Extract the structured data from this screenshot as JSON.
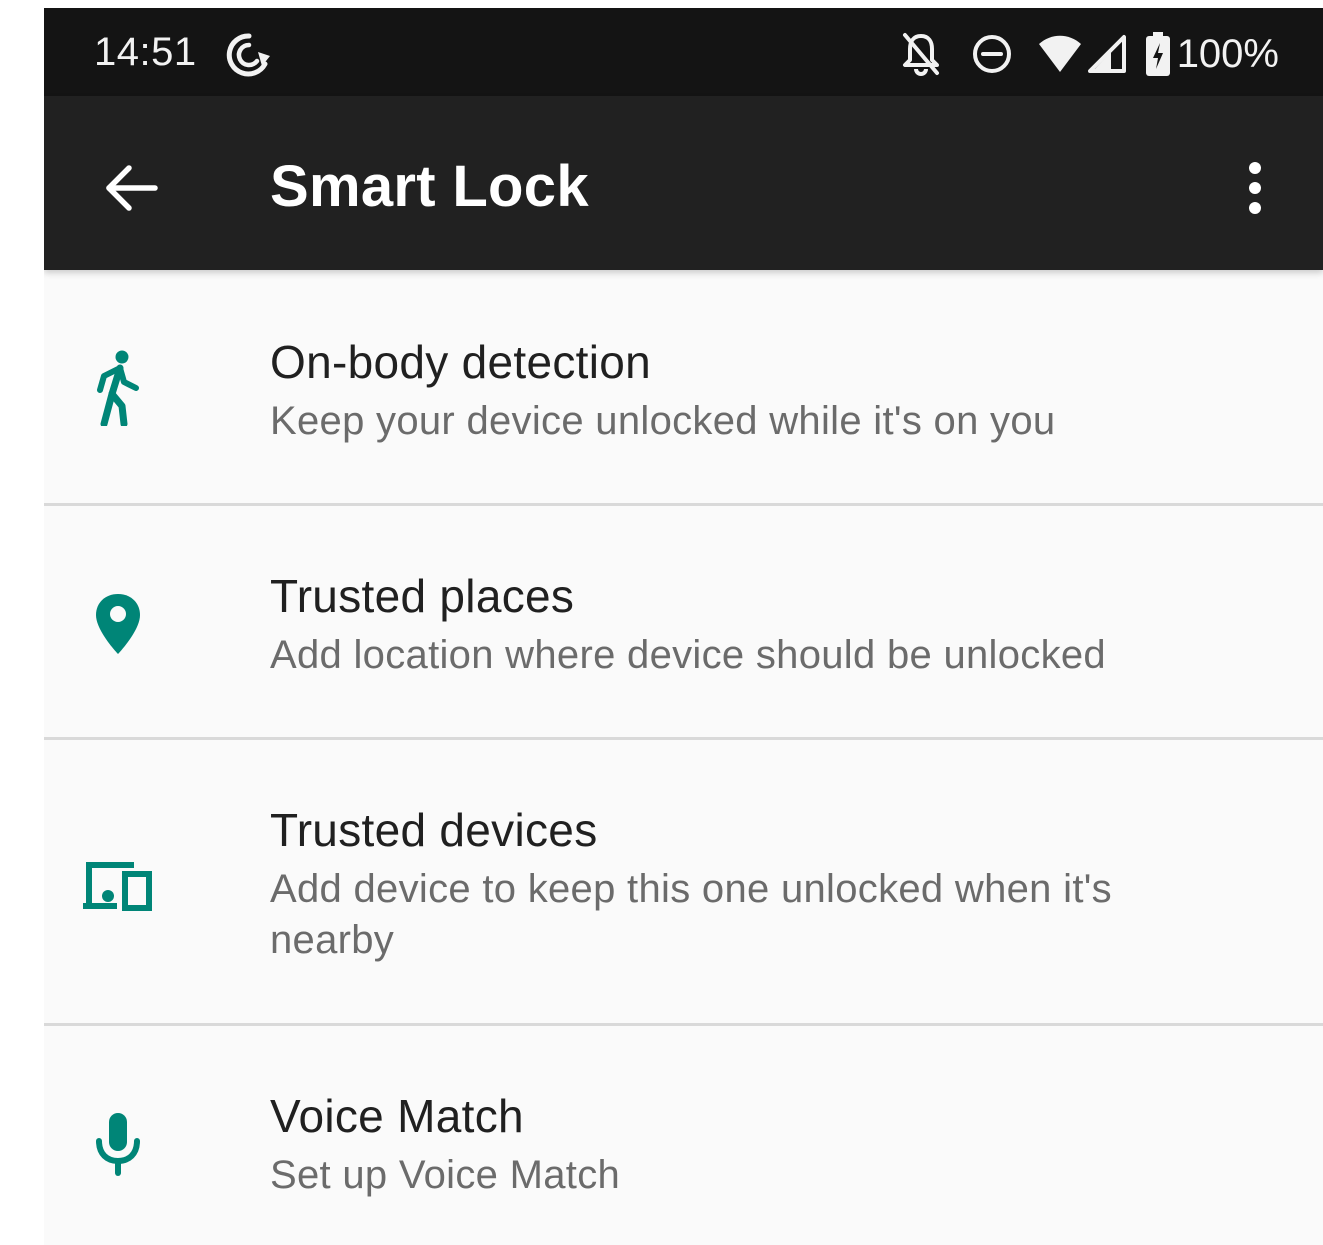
{
  "status_bar": {
    "time": "14:51",
    "battery_percent": "100%",
    "icons": [
      "sync-icon",
      "notifications-off-icon",
      "do-not-disturb-icon",
      "wifi-icon",
      "cell-signal-icon",
      "battery-charging-icon"
    ]
  },
  "app_bar": {
    "title": "Smart Lock",
    "back_icon": "arrow-back-icon",
    "overflow_icon": "more-vert-icon"
  },
  "colors": {
    "accent": "#008577",
    "app_bar": "#212121",
    "status_bar": "#141414",
    "background": "#fafafa",
    "divider": "#d9d9d9"
  },
  "list": {
    "items": [
      {
        "title": "On-body detection",
        "subtitle": "Keep your device unlocked while it's on you",
        "icon": "walking-person-icon"
      },
      {
        "title": "Trusted places",
        "subtitle": "Add location where device should be unlocked",
        "icon": "location-pin-icon"
      },
      {
        "title": "Trusted devices",
        "subtitle": "Add device to keep this one unlocked when it's nearby",
        "icon": "devices-icon"
      },
      {
        "title": "Voice Match",
        "subtitle": "Set up Voice Match",
        "icon": "microphone-icon"
      }
    ]
  }
}
